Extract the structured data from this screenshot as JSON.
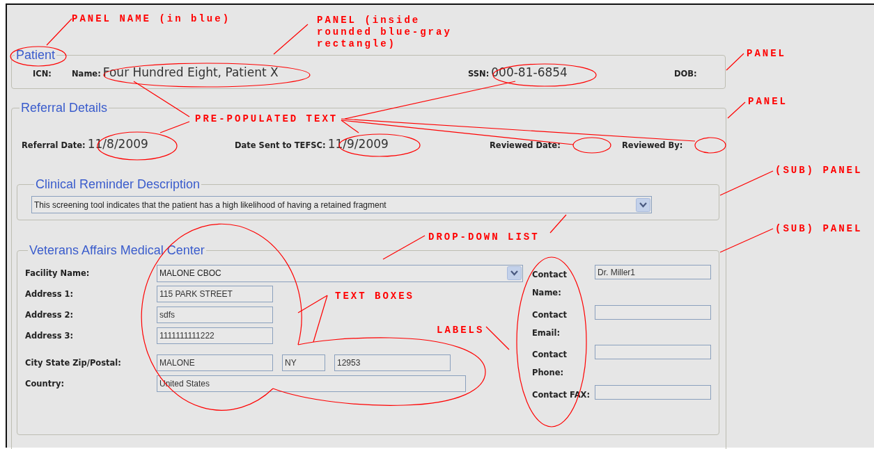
{
  "patient": {
    "legend": "Patient",
    "fields": [
      {
        "label": "ICN:"
      },
      {
        "label": "Name:",
        "value": "Four Hundred Eight, Patient X"
      },
      {
        "label": "SSN:",
        "value": "000-81-6854"
      },
      {
        "label": "DOB:"
      }
    ]
  },
  "referral_details": {
    "legend": "Referral Details",
    "fields": [
      {
        "label": "Referral Date:",
        "value": "11/8/2009"
      },
      {
        "label": "Date Sent to TEFSC:",
        "value": "11/9/2009"
      },
      {
        "label": "Reviewed Date:"
      },
      {
        "label": "Reviewed By:"
      }
    ],
    "clinical_reminder": {
      "legend": "Clinical Reminder Description",
      "dropdown": {
        "value": "This screening tool indicates that the patient has a high likelihood of having a retained fragment"
      }
    },
    "medical_center": {
      "legend": "Veterans Affairs Medical Center",
      "rows": [
        {
          "label": "Facility Name:",
          "kind": "dropdown",
          "values": [
            "MALONE CBOC"
          ]
        },
        {
          "label": "Address 1:",
          "kind": "text",
          "values": [
            "115 PARK STREET"
          ]
        },
        {
          "label": "Address 2:",
          "kind": "text",
          "values": [
            "sdfs"
          ]
        },
        {
          "label": "Address 3:",
          "kind": "text",
          "values": [
            "1111111111222"
          ]
        },
        {
          "label": "City State Zip/Postal:",
          "kind": "text",
          "values": [
            "MALONE",
            "NY",
            "12953"
          ]
        },
        {
          "label": "Country:",
          "kind": "text",
          "values": [
            "United States"
          ]
        }
      ],
      "contacts": [
        {
          "label": "Contact Name:",
          "value": "Dr. Miller1"
        },
        {
          "label": "Contact Email:"
        },
        {
          "label": "Contact Phone:"
        },
        {
          "label": "Contact FAX:"
        }
      ]
    }
  },
  "annotations": [
    {
      "text": "PANEL NAME (in blue)"
    },
    {
      "text": "PANEL (inside rounded blue-gray rectangle)"
    },
    {
      "text": "PANEL"
    },
    {
      "text": "PANEL"
    },
    {
      "text": "PRE-POPULATED TEXT"
    },
    {
      "text": "(SUB) PANEL"
    },
    {
      "text": "(SUB) PANEL"
    },
    {
      "text": "DROP-DOWN LIST"
    },
    {
      "text": "TEXT BOXES"
    },
    {
      "text": "LABELS"
    }
  ]
}
